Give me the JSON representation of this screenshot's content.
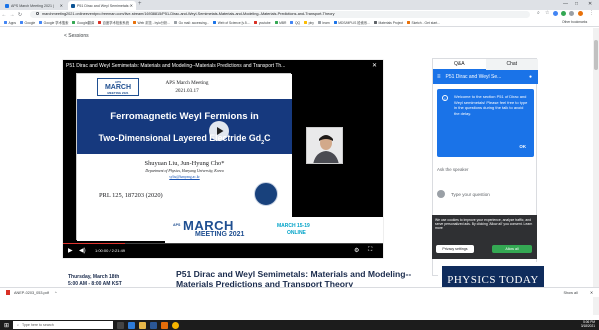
{
  "browser": {
    "tabs": [
      {
        "title": "APS March Meeting 2021 |",
        "active": false
      },
      {
        "title": "P51 Dirac and Weyl Semimetals:",
        "active": true
      }
    ],
    "new_tab": "+",
    "url": "marchmeeting2021.onlineeventpro.freeman.com/live-stream/16938815/P51-Dirac-and-Weyl-Semimetals-Materials-and-Modeling--Materials-Predictions-and-Transport-Theory",
    "bookmarks": [
      "Apps",
      "Google",
      "Google 学术搜索",
      "Google翻译",
      "百度学术检索系统",
      "Web 浏览 - bylo分析...",
      "Go mail: accessing...",
      "Web of Science [v.5....",
      "youtube",
      "MBR",
      "QQ",
      "pby",
      "learn",
      "MDS/MPLIS 检索系...",
      "Materials Project",
      "Sketch - Get start..."
    ],
    "other_bookmarks": "Other bookmarks",
    "download_file": "ANEP-0203_053.pdf",
    "show_all": "Show all"
  },
  "page": {
    "back_link": "< Sessions",
    "player_title": "P51 Dirac and Weyl Semimetals: Materials and Modeling--Materials Predictions and Transport Th...",
    "slide": {
      "meeting_logo_top": "APS",
      "meeting_logo_main": "MARCH",
      "meeting_logo_sub": "MEETING 2021",
      "meeting_name": "APS March Meeting",
      "meeting_date": "2021.03.17",
      "title_line1": "Ferromagnetic Weyl Fermions in",
      "title_line2": "Two-Dimensional Layered Electride Gd",
      "title_sub": "2",
      "title_end": "C",
      "authors": "Shuyuan Liu, Jun-Hyung Cho*",
      "affiliation": "Department of Physics, Hanyang University, Korea",
      "email": "syliu@hanyang.ac.kr",
      "reference": "PRL 125, 187203 (2020)"
    },
    "promo": {
      "aps": "APS",
      "march": "MARCH",
      "meeting": "MEETING 2021",
      "dates": "MARCH 15-19",
      "online": "ONLINE"
    },
    "time_display": "1:00:00 / 2:21:49",
    "session_date": "Thursday, March 18th",
    "session_time": "5:00 AM - 8:00 AM KST",
    "session_title": "P51 Dirac and Weyl Semimetals: Materials and Modeling--Materials Predictions and Transport Theory"
  },
  "chat": {
    "tab_qa": "Q&A",
    "tab_chat": "Chat",
    "header": "P51 Dirac and Weyl Se...",
    "welcome": "Welcome to the section P51 of Dirac and Weyl semimetals! Please feel free to type in the questions during the talk to avoid the delay.",
    "ok": "OK",
    "ask_speaker": "Ask the speaker",
    "input_placeholder": "Type your question"
  },
  "cookie": {
    "text": "We use cookies to improve your experience, analyze traffic, and serve personalized ads. By clicking 'Allow all' you consent. Learn more",
    "settings": "Privacy settings",
    "allow": "Allow all"
  },
  "ad": {
    "text": "PHYSICS TODAY"
  },
  "taskbar": {
    "search": "Type here to search",
    "time": "5:06 PM",
    "date": "3/18/2021"
  }
}
